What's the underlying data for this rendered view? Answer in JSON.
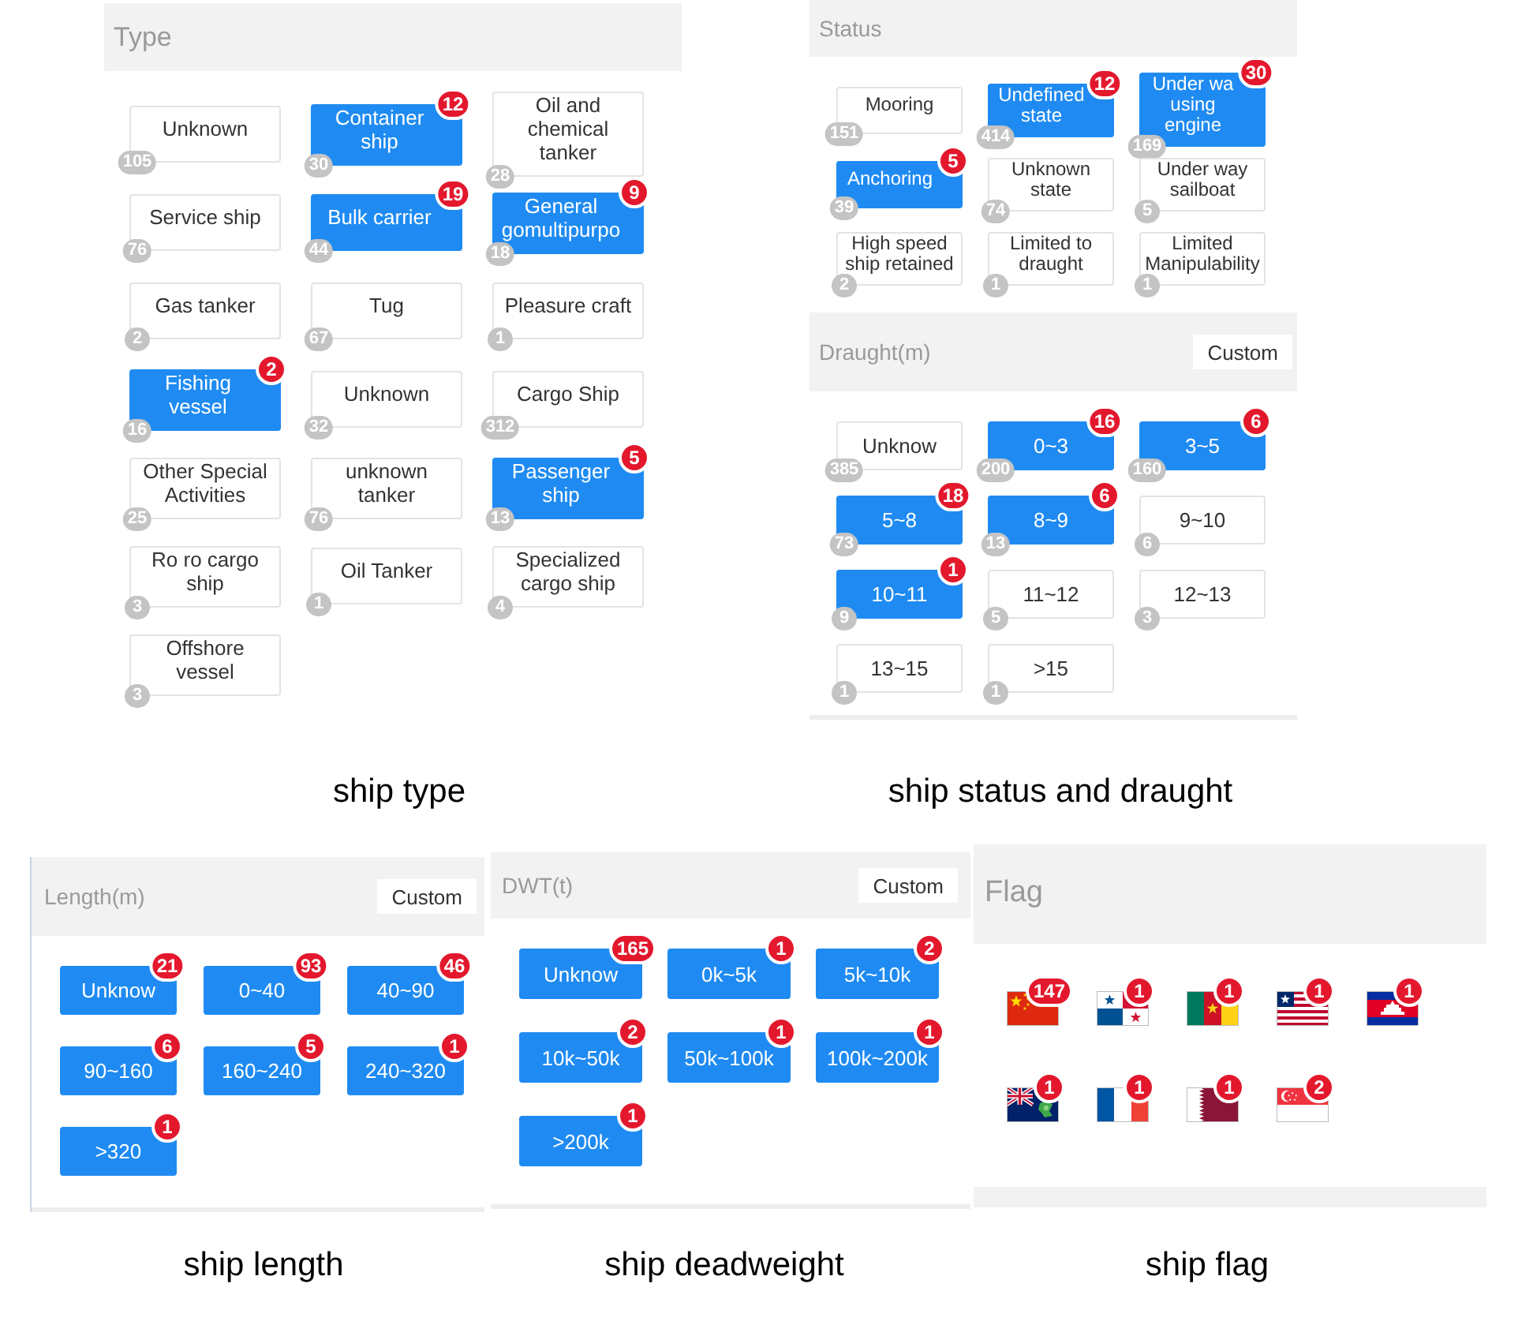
{
  "type_figure": {
    "section": {
      "title": "Type",
      "items": [
        {
          "label": "Unknown",
          "count": "105",
          "selected": false
        },
        {
          "label": "Container ship",
          "count": "30",
          "selected": true,
          "badge": "12"
        },
        {
          "label": "Oil and chemical tanker",
          "count": "28",
          "selected": false
        },
        {
          "label": "Service ship",
          "count": "76",
          "selected": false
        },
        {
          "label": "Bulk carrier",
          "count": "44",
          "selected": true,
          "badge": "19"
        },
        {
          "label": "General gomultipurpo",
          "count": "18",
          "selected": true,
          "badge": "9"
        },
        {
          "label": "Gas tanker",
          "count": "2",
          "selected": false
        },
        {
          "label": "Tug",
          "count": "67",
          "selected": false
        },
        {
          "label": "Pleasure craft",
          "count": "1",
          "selected": false
        },
        {
          "label": "Fishing vessel",
          "count": "16",
          "selected": true,
          "badge": "2"
        },
        {
          "label": "Unknown",
          "count": "32",
          "selected": false
        },
        {
          "label": "Cargo Ship",
          "count": "312",
          "selected": false
        },
        {
          "label": "Other Special Activities",
          "count": "25",
          "selected": false
        },
        {
          "label": "unknown tanker",
          "count": "76",
          "selected": false
        },
        {
          "label": "Passenger ship",
          "count": "13",
          "selected": true,
          "badge": "5"
        },
        {
          "label": "Ro ro cargo ship",
          "count": "3",
          "selected": false
        },
        {
          "label": "Oil Tanker",
          "count": "1",
          "selected": false
        },
        {
          "label": "Specialized cargo ship",
          "count": "4",
          "selected": false
        },
        {
          "label": "Offshore vessel",
          "count": "3",
          "selected": false
        }
      ]
    },
    "caption": "ship type"
  },
  "status_draught_figure": {
    "sections": [
      {
        "title": "Status",
        "items": [
          {
            "label": "Mooring",
            "count": "151",
            "selected": false
          },
          {
            "label": "Undefined state",
            "count": "414",
            "selected": true,
            "badge": "12"
          },
          {
            "label": "Under wa using engine",
            "count": "169",
            "selected": true,
            "badge": "30"
          },
          {
            "label": "Anchoring",
            "count": "39",
            "selected": true,
            "badge": "5"
          },
          {
            "label": "Unknown state",
            "count": "74",
            "selected": false
          },
          {
            "label": "Under way sailboat",
            "count": "5",
            "selected": false
          },
          {
            "label": "High speed ship retained",
            "count": "2",
            "selected": false
          },
          {
            "label": "Limited to draught",
            "count": "1",
            "selected": false
          },
          {
            "label": "Limited Manipulability",
            "count": "1",
            "selected": false
          }
        ]
      },
      {
        "title": "Draught(m)",
        "custom_button": "Custom",
        "items": [
          {
            "label": "Unknow",
            "count": "385",
            "selected": false
          },
          {
            "label": "0~3",
            "count": "200",
            "selected": true,
            "badge": "16"
          },
          {
            "label": "3~5",
            "count": "160",
            "selected": true,
            "badge": "6"
          },
          {
            "label": "5~8",
            "count": "73",
            "selected": true,
            "badge": "18"
          },
          {
            "label": "8~9",
            "count": "13",
            "selected": true,
            "badge": "6"
          },
          {
            "label": "9~10",
            "count": "6",
            "selected": false
          },
          {
            "label": "10~11",
            "count": "9",
            "selected": true,
            "badge": "1"
          },
          {
            "label": "11~12",
            "count": "5",
            "selected": false
          },
          {
            "label": "12~13",
            "count": "3",
            "selected": false
          },
          {
            "label": "13~15",
            "count": "1",
            "selected": false
          },
          {
            "label": ">15",
            "count": "1",
            "selected": false
          }
        ]
      }
    ],
    "caption": "ship status and draught"
  },
  "length_figure": {
    "section": {
      "title": "Length(m)",
      "custom_button": "Custom",
      "items": [
        {
          "label": "Unknow",
          "selected": true,
          "badge": "21"
        },
        {
          "label": "0~40",
          "selected": true,
          "badge": "93"
        },
        {
          "label": "40~90",
          "selected": true,
          "badge": "46"
        },
        {
          "label": "90~160",
          "selected": true,
          "badge": "6"
        },
        {
          "label": "160~240",
          "selected": true,
          "badge": "5"
        },
        {
          "label": "240~320",
          "selected": true,
          "badge": "1"
        },
        {
          "label": ">320",
          "selected": true,
          "badge": "1"
        }
      ]
    },
    "caption": "ship length"
  },
  "dwt_figure": {
    "section": {
      "title": "DWT(t)",
      "custom_button": "Custom",
      "items": [
        {
          "label": "Unknow",
          "selected": true,
          "badge": "165"
        },
        {
          "label": "0k~5k",
          "selected": true,
          "badge": "1"
        },
        {
          "label": "5k~10k",
          "selected": true,
          "badge": "2"
        },
        {
          "label": "10k~50k",
          "selected": true,
          "badge": "2"
        },
        {
          "label": "50k~100k",
          "selected": true,
          "badge": "1"
        },
        {
          "label": "100k~200k",
          "selected": true,
          "badge": "1"
        },
        {
          "label": ">200k",
          "selected": true,
          "badge": "1"
        }
      ]
    },
    "caption": "ship deadweight"
  },
  "flag_figure": {
    "section": {
      "title": "Flag",
      "flags": [
        {
          "kind": "china",
          "badge": "147"
        },
        {
          "kind": "panama",
          "badge": "1"
        },
        {
          "kind": "cameroon",
          "badge": "1"
        },
        {
          "kind": "liberia",
          "badge": "1"
        },
        {
          "kind": "cambodia",
          "badge": "1"
        },
        {
          "kind": "ensign",
          "badge": "1"
        },
        {
          "kind": "france",
          "badge": "1"
        },
        {
          "kind": "qatar",
          "badge": "1"
        },
        {
          "kind": "singapore",
          "badge": "2"
        }
      ]
    },
    "caption": "ship flag"
  }
}
